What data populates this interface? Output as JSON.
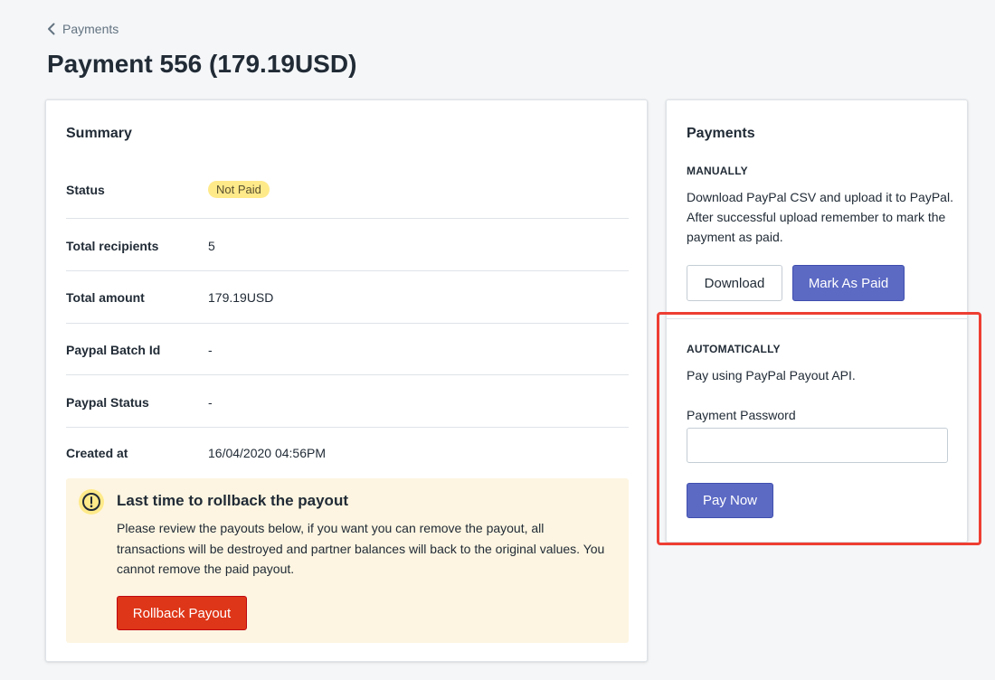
{
  "breadcrumb": {
    "label": "Payments"
  },
  "page": {
    "title": "Payment 556 (179.19USD)"
  },
  "summary": {
    "title": "Summary",
    "rows": [
      {
        "label": "Status",
        "value": "Not Paid"
      },
      {
        "label": "Total recipients",
        "value": "5"
      },
      {
        "label": "Total amount",
        "value": "179.19USD"
      },
      {
        "label": "Paypal Batch Id",
        "value": "-"
      },
      {
        "label": "Paypal Status",
        "value": "-"
      },
      {
        "label": "Created at",
        "value": "16/04/2020 04:56PM"
      }
    ],
    "banner": {
      "title": "Last time to rollback the payout",
      "text": "Please review the payouts below, if you want you can remove the payout, all transactions will be destroyed and partner balances will back to the original values. You cannot remove the paid payout.",
      "button": "Rollback Payout"
    }
  },
  "payments": {
    "title": "Payments",
    "manually": {
      "heading": "MANUALLY",
      "text": "Download PayPal CSV and upload it to PayPal. After successful upload remember to mark the payment as paid.",
      "download_button": "Download",
      "mark_paid_button": "Mark As Paid"
    },
    "automatically": {
      "heading": "AUTOMATICALLY",
      "text": "Pay using PayPal Payout API.",
      "password_label": "Payment Password",
      "password_value": "",
      "pay_button": "Pay Now"
    }
  },
  "colors": {
    "accent": "#5c6ac4",
    "danger": "#de3618",
    "badge_warning": "#ffea8a",
    "banner_bg": "#fdf5e1",
    "highlight": "#ee3e33"
  },
  "icons": {
    "back": "chevron-left-icon",
    "warning": "exclamation-circle-icon"
  }
}
